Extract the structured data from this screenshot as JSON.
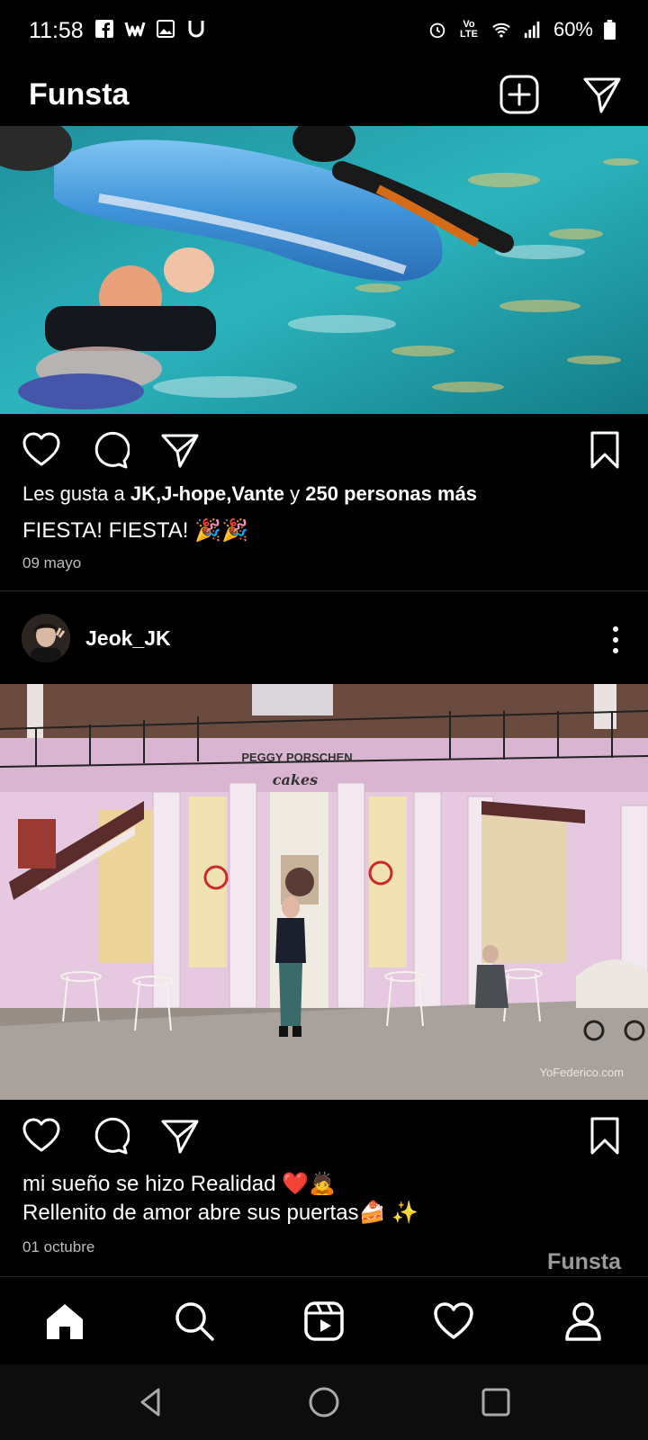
{
  "status_bar": {
    "time": "11:58",
    "left_icons": [
      "facebook-icon",
      "webtoon-icon",
      "gallery-icon",
      "u-app-icon"
    ],
    "right_icons": [
      "alarm-icon",
      "volte-icon",
      "wifi-icon",
      "signal-icon",
      "battery-icon"
    ],
    "volte_label": "Vo LTE",
    "battery": "60%"
  },
  "app": {
    "title": "Funsta",
    "new_post_icon": "add-square-icon",
    "direct_icon": "send-icon"
  },
  "post1": {
    "image_alt": "pool-party-photo",
    "likes_prefix": "Les gusta a ",
    "likes_names": "JK,J-hope,Vante",
    "likes_mid": " y ",
    "likes_count": "250 personas más",
    "caption": "FIESTA! FIESTA! 🎉🎉",
    "date": "09 mayo"
  },
  "post2": {
    "username": "Jeok_JK",
    "image_alt": "peggy-porschen-storefront-photo",
    "shop_sign_line1": "PEGGY PORSCHEN",
    "shop_sign_line2": "cakes",
    "image_credit": "YoFederico.com",
    "caption_line1": "mi sueño se hizo Realidad ❤️🙇",
    "caption_line2": "Rellenito de amor abre sus puertas🍰 ✨",
    "date": "01 octubre"
  },
  "watermark": "Funsta",
  "bottom_nav": [
    "home-icon",
    "search-icon",
    "reels-icon",
    "heart-icon",
    "profile-icon"
  ],
  "system_nav": [
    "back-icon",
    "home-circle-icon",
    "recents-icon"
  ],
  "colors": {
    "background": "#000000",
    "text": "#ffffff",
    "muted": "#bdbdbd",
    "heart": "#e0245e"
  }
}
